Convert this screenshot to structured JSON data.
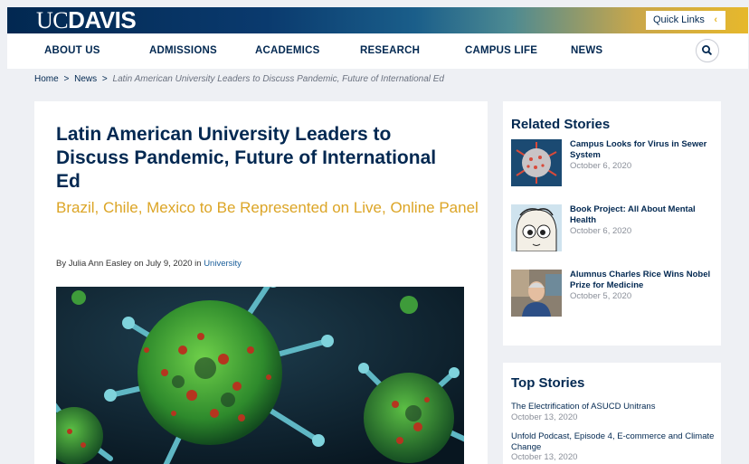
{
  "header": {
    "logo_uc": "UC",
    "logo_davis": "DAVIS",
    "quick_links": "Quick Links",
    "quick_links_chevron": "‹"
  },
  "nav": {
    "items": [
      "ABOUT US",
      "ADMISSIONS",
      "ACADEMICS",
      "RESEARCH",
      "CAMPUS LIFE",
      "NEWS"
    ]
  },
  "breadcrumb": {
    "home": "Home",
    "news": "News",
    "sep": ">",
    "current": "Latin American University Leaders to Discuss Pandemic, Future of International Ed"
  },
  "article": {
    "title": "Latin American University Leaders to Discuss Pandemic, Future of International Ed",
    "subtitle": "Brazil, Chile, Mexico to Be Represented on Live, Online Panel",
    "byline_prefix": "By Julia Ann Easley on July 9, 2020 in ",
    "category": "University"
  },
  "related": {
    "heading": "Related Stories",
    "items": [
      {
        "title": "Campus Looks for Virus in Sewer System",
        "date": "October 6, 2020"
      },
      {
        "title": "Book Project: All About Mental Health",
        "date": "October 6, 2020"
      },
      {
        "title": "Alumnus Charles Rice Wins Nobel Prize for Medicine",
        "date": "October 5, 2020"
      }
    ]
  },
  "top": {
    "heading": "Top Stories",
    "items": [
      {
        "title": "The Electrification of ASUCD Unitrans",
        "date": "October 13, 2020"
      },
      {
        "title": "Unfold Podcast, Episode 4, E-commerce and Climate Change",
        "date": "October 13, 2020"
      }
    ]
  },
  "colors": {
    "navy": "#022851",
    "gold": "#dca526",
    "link_blue": "#1a5e9a"
  }
}
